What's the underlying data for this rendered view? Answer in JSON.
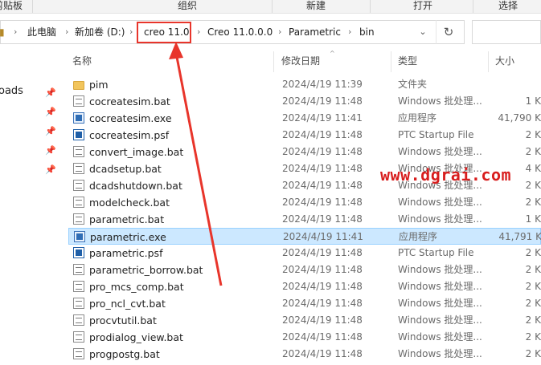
{
  "ribbon": {
    "groups": [
      "剪贴板",
      "组织",
      "新建",
      "打开",
      "选择"
    ]
  },
  "address": {
    "crumbs": [
      "此电脑",
      "新加卷 (D:)",
      "creo 11.0",
      "Creo 11.0.0.0",
      "Parametric",
      "bin"
    ]
  },
  "nav": {
    "items": [
      "oads"
    ]
  },
  "columns": {
    "name": "名称",
    "modified": "修改日期",
    "type": "类型",
    "size": "大小"
  },
  "files": [
    {
      "name": "pim",
      "date": "2024/4/19 11:39",
      "type": "文件夹",
      "size": "",
      "icon": "folder-icon"
    },
    {
      "name": "cocreatesim.bat",
      "date": "2024/4/19 11:48",
      "type": "Windows 批处理...",
      "size": "1 K",
      "icon": "bat-file-icon"
    },
    {
      "name": "cocreatesim.exe",
      "date": "2024/4/19 11:41",
      "type": "应用程序",
      "size": "41,790 K",
      "icon": "exe-file-icon"
    },
    {
      "name": "cocreatesim.psf",
      "date": "2024/4/19 11:48",
      "type": "PTC Startup File",
      "size": "2 K",
      "icon": "psf-file-icon"
    },
    {
      "name": "convert_image.bat",
      "date": "2024/4/19 11:48",
      "type": "Windows 批处理...",
      "size": "2 K",
      "icon": "bat-file-icon"
    },
    {
      "name": "dcadsetup.bat",
      "date": "2024/4/19 11:48",
      "type": "Windows 批处理...",
      "size": "4 K",
      "icon": "bat-file-icon"
    },
    {
      "name": "dcadshutdown.bat",
      "date": "2024/4/19 11:48",
      "type": "Windows 批处理...",
      "size": "2 K",
      "icon": "bat-file-icon"
    },
    {
      "name": "modelcheck.bat",
      "date": "2024/4/19 11:48",
      "type": "Windows 批处理...",
      "size": "2 K",
      "icon": "bat-file-icon"
    },
    {
      "name": "parametric.bat",
      "date": "2024/4/19 11:48",
      "type": "Windows 批处理...",
      "size": "1 K",
      "icon": "bat-file-icon"
    },
    {
      "name": "parametric.exe",
      "date": "2024/4/19 11:41",
      "type": "应用程序",
      "size": "41,791 K",
      "icon": "exe-file-icon",
      "selected": true
    },
    {
      "name": "parametric.psf",
      "date": "2024/4/19 11:48",
      "type": "PTC Startup File",
      "size": "2 K",
      "icon": "psf-file-icon"
    },
    {
      "name": "parametric_borrow.bat",
      "date": "2024/4/19 11:48",
      "type": "Windows 批处理...",
      "size": "2 K",
      "icon": "bat-file-icon"
    },
    {
      "name": "pro_mcs_comp.bat",
      "date": "2024/4/19 11:48",
      "type": "Windows 批处理...",
      "size": "2 K",
      "icon": "bat-file-icon"
    },
    {
      "name": "pro_ncl_cvt.bat",
      "date": "2024/4/19 11:48",
      "type": "Windows 批处理...",
      "size": "2 K",
      "icon": "bat-file-icon"
    },
    {
      "name": "procvtutil.bat",
      "date": "2024/4/19 11:48",
      "type": "Windows 批处理...",
      "size": "2 K",
      "icon": "bat-file-icon"
    },
    {
      "name": "prodialog_view.bat",
      "date": "2024/4/19 11:48",
      "type": "Windows 批处理...",
      "size": "2 K",
      "icon": "bat-file-icon"
    },
    {
      "name": "progpostg.bat",
      "date": "2024/4/19 11:48",
      "type": "Windows 批处理...",
      "size": "2 K",
      "icon": "bat-file-icon"
    }
  ],
  "watermark": "www.dgrai.com",
  "colors": {
    "highlight": "#e8352b",
    "selection": "#cce8ff",
    "watermark": "#d81e1e"
  }
}
